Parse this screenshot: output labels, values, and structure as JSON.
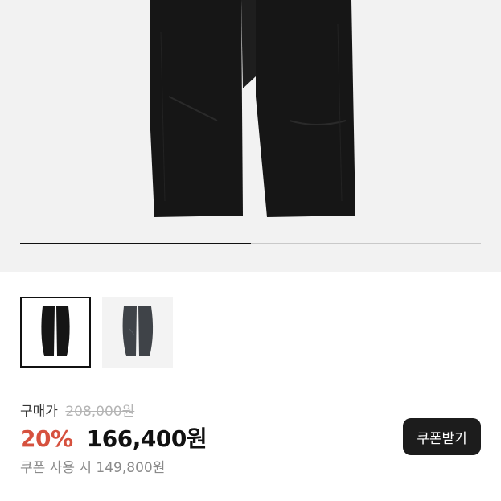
{
  "gallery": {
    "progress_fraction": 0.5,
    "thumbnails": [
      {
        "name": "black",
        "color": "#151515",
        "selected": true
      },
      {
        "name": "charcoal",
        "color": "#3f4348",
        "selected": false
      }
    ]
  },
  "price": {
    "label": "구매가",
    "original": "208,000원",
    "discount_percent": "20%",
    "sale_price": "166,400원",
    "coupon_price_text": "쿠폰 사용 시 149,800원"
  },
  "coupon_button": {
    "label": "쿠폰받기"
  },
  "colors": {
    "discount_accent": "#d6513e",
    "button_bg": "#1c1c1c"
  }
}
